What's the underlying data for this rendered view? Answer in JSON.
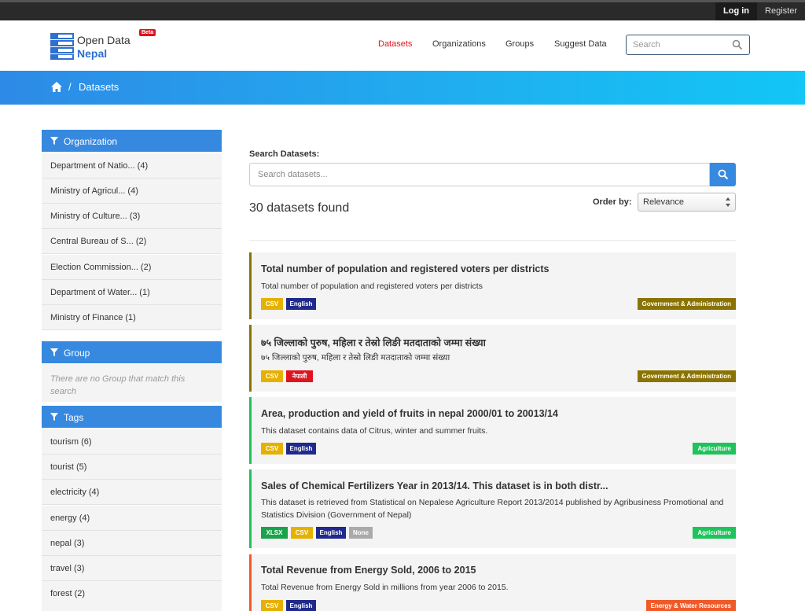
{
  "topbar": {
    "login": "Log in",
    "register": "Register"
  },
  "header": {
    "logo_line1": "Open Data",
    "logo_line2": "Nepal",
    "beta": "Beta",
    "nav": [
      "Datasets",
      "Organizations",
      "Groups",
      "Suggest Data"
    ],
    "active_nav": "Datasets",
    "search_placeholder": "Search"
  },
  "breadcrumb": {
    "current": "Datasets"
  },
  "sidebar": {
    "organization": {
      "title": "Organization",
      "items": [
        "Department of Natio... (4)",
        "Ministry of Agricul... (4)",
        "Ministry of Culture... (3)",
        "Central Bureau of S... (2)",
        "Election Commission... (2)",
        "Department of Water... (1)",
        "Ministry of Finance (1)"
      ]
    },
    "group": {
      "title": "Group",
      "empty": "There are no Group that match this search"
    },
    "tags": {
      "title": "Tags",
      "items": [
        "tourism (6)",
        "tourist (5)",
        "electricity (4)",
        "energy (4)",
        "nepal (3)",
        "travel (3)",
        "forest (2)"
      ]
    }
  },
  "main": {
    "search_label": "Search Datasets:",
    "search_placeholder": "Search datasets...",
    "found": "30 datasets found",
    "order_label": "Order by:",
    "order_value": "Relevance"
  },
  "colors": {
    "accent": "#3789e0",
    "gov": "#8a7300",
    "agri": "#1fc35b",
    "energy": "#f05a28",
    "csv": "#e5b100",
    "english": "#1f2a8c",
    "nepali": "#e0141e",
    "xlsx": "#1aa34a",
    "none": "#aaaaaa"
  },
  "datasets": [
    {
      "title": "Total number of population and registered voters per districts",
      "description": "Total number of population and registered voters per districts",
      "tags": [
        "CSV",
        "English"
      ],
      "category": "Government & Administration"
    },
    {
      "title": "७५ जिल्लाको पुरुष, महिला र तेस्रो लिङी मतदाताको जम्मा संख्या",
      "description": "७५ जिल्लाको पुरुष, महिला र तेस्रो लिङी मतदाताको जम्मा संख्या",
      "tags": [
        "CSV",
        "नेपाली"
      ],
      "category": "Government & Administration"
    },
    {
      "title": "Area, production and yield of fruits in nepal 2000/01 to 20013/14",
      "description": "This dataset contains data of Citrus, winter and summer fruits.",
      "tags": [
        "CSV",
        "English"
      ],
      "category": "Agriculture"
    },
    {
      "title": "Sales of Chemical Fertilizers Year in 2013/14. This dataset is in both distr...",
      "description": "This dataset is retrieved from Statistical on Nepalese Agriculture Report 2013/2014 published by Agribusiness Promotional and Statistics Division (Government of Nepal)",
      "tags": [
        "XLSX",
        "CSV",
        "English",
        "None"
      ],
      "category": "Agriculture"
    },
    {
      "title": "Total Revenue from Energy Sold, 2006 to 2015",
      "description": "Total Revenue from Energy Sold in millions from year 2006 to 2015.",
      "tags": [
        "CSV",
        "English"
      ],
      "category": "Energy & Water Resources"
    }
  ]
}
